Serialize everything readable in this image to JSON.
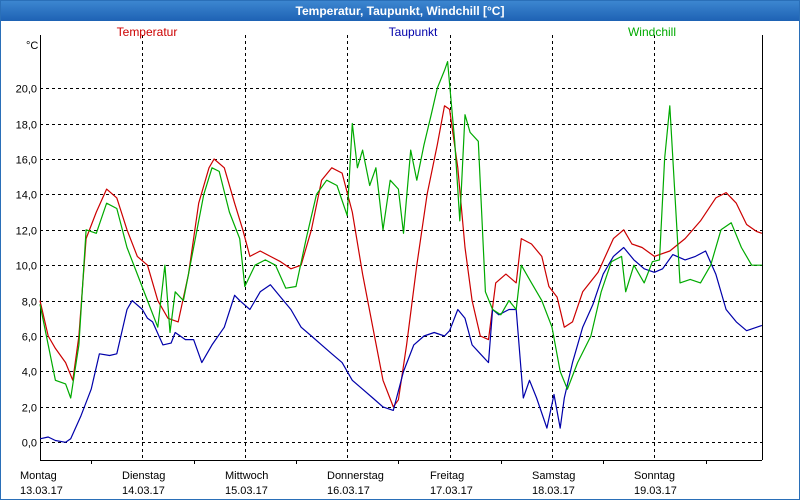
{
  "window": {
    "title": "Temperatur, Taupunkt, Windchill [°C]"
  },
  "chart_data": {
    "type": "line",
    "title": "Temperatur, Taupunkt, Windchill [°C]",
    "ylabel": "°C",
    "ylim": [
      -1.0,
      23.0
    ],
    "xlim": [
      0,
      7.05
    ],
    "grid": true,
    "x_unit_note": "days from Montag 13.03.17 00:00",
    "y_ticks": [
      "0,0",
      "2,0",
      "4,0",
      "6,0",
      "8,0",
      "10,0",
      "12,0",
      "14,0",
      "16,0",
      "18,0",
      "20,0"
    ],
    "y_tick_values": [
      0,
      2,
      4,
      6,
      8,
      10,
      12,
      14,
      16,
      18,
      20
    ],
    "x_ticks": [
      {
        "day": "Montag",
        "date": "13.03.17",
        "x": 0
      },
      {
        "day": "Dienstag",
        "date": "14.03.17",
        "x": 1
      },
      {
        "day": "Mittwoch",
        "date": "15.03.17",
        "x": 2
      },
      {
        "day": "Donnerstag",
        "date": "16.03.17",
        "x": 3
      },
      {
        "day": "Freitag",
        "date": "17.03.17",
        "x": 4
      },
      {
        "day": "Samstag",
        "date": "18.03.17",
        "x": 5
      },
      {
        "day": "Sonntag",
        "date": "19.03.17",
        "x": 6
      }
    ],
    "series": [
      {
        "name": "Temperatur",
        "color": "#cc0000",
        "points": [
          [
            0,
            8.0
          ],
          [
            0.08,
            6.0
          ],
          [
            0.15,
            5.3
          ],
          [
            0.25,
            4.5
          ],
          [
            0.32,
            3.5
          ],
          [
            0.38,
            6.0
          ],
          [
            0.45,
            11.5
          ],
          [
            0.55,
            13.0
          ],
          [
            0.65,
            14.3
          ],
          [
            0.75,
            13.8
          ],
          [
            0.85,
            12.0
          ],
          [
            0.95,
            10.5
          ],
          [
            1.05,
            10.0
          ],
          [
            1.15,
            8.0
          ],
          [
            1.25,
            7.0
          ],
          [
            1.35,
            6.8
          ],
          [
            1.45,
            9.5
          ],
          [
            1.55,
            13.5
          ],
          [
            1.65,
            15.5
          ],
          [
            1.7,
            16.0
          ],
          [
            1.8,
            15.5
          ],
          [
            1.9,
            13.5
          ],
          [
            1.98,
            12.0
          ],
          [
            2.05,
            10.5
          ],
          [
            2.15,
            10.8
          ],
          [
            2.25,
            10.5
          ],
          [
            2.35,
            10.2
          ],
          [
            2.45,
            9.8
          ],
          [
            2.55,
            10.0
          ],
          [
            2.65,
            12.0
          ],
          [
            2.75,
            14.8
          ],
          [
            2.85,
            15.5
          ],
          [
            2.95,
            15.2
          ],
          [
            3.05,
            13.0
          ],
          [
            3.15,
            9.5
          ],
          [
            3.25,
            6.5
          ],
          [
            3.35,
            3.5
          ],
          [
            3.45,
            2.0
          ],
          [
            3.5,
            2.4
          ],
          [
            3.58,
            5.5
          ],
          [
            3.68,
            10.0
          ],
          [
            3.78,
            14.0
          ],
          [
            3.88,
            16.8
          ],
          [
            3.95,
            19.0
          ],
          [
            4.0,
            18.8
          ],
          [
            4.08,
            15.5
          ],
          [
            4.15,
            11.0
          ],
          [
            4.22,
            8.0
          ],
          [
            4.3,
            6.0
          ],
          [
            4.38,
            5.8
          ],
          [
            4.45,
            9.0
          ],
          [
            4.55,
            9.5
          ],
          [
            4.65,
            9.0
          ],
          [
            4.7,
            11.5
          ],
          [
            4.8,
            11.2
          ],
          [
            4.9,
            10.5
          ],
          [
            4.97,
            8.8
          ],
          [
            5.05,
            8.2
          ],
          [
            5.12,
            6.5
          ],
          [
            5.2,
            6.8
          ],
          [
            5.3,
            8.5
          ],
          [
            5.45,
            9.6
          ],
          [
            5.6,
            11.5
          ],
          [
            5.7,
            12.0
          ],
          [
            5.78,
            11.2
          ],
          [
            5.88,
            11.0
          ],
          [
            6.0,
            10.5
          ],
          [
            6.15,
            10.8
          ],
          [
            6.3,
            11.5
          ],
          [
            6.45,
            12.5
          ],
          [
            6.6,
            13.8
          ],
          [
            6.7,
            14.1
          ],
          [
            6.8,
            13.5
          ],
          [
            6.9,
            12.3
          ],
          [
            7.0,
            11.9
          ],
          [
            7.05,
            11.8
          ]
        ]
      },
      {
        "name": "Taupunkt",
        "color": "#0000aa",
        "points": [
          [
            0,
            0.2
          ],
          [
            0.08,
            0.3
          ],
          [
            0.15,
            0.1
          ],
          [
            0.25,
            0.0
          ],
          [
            0.3,
            0.2
          ],
          [
            0.4,
            1.5
          ],
          [
            0.5,
            3.0
          ],
          [
            0.58,
            5.0
          ],
          [
            0.68,
            4.9
          ],
          [
            0.75,
            5.0
          ],
          [
            0.85,
            7.5
          ],
          [
            0.9,
            8.0
          ],
          [
            1.0,
            7.5
          ],
          [
            1.05,
            7.0
          ],
          [
            1.1,
            6.8
          ],
          [
            1.2,
            5.5
          ],
          [
            1.28,
            5.6
          ],
          [
            1.32,
            6.2
          ],
          [
            1.42,
            5.8
          ],
          [
            1.5,
            5.8
          ],
          [
            1.58,
            4.5
          ],
          [
            1.68,
            5.5
          ],
          [
            1.8,
            6.5
          ],
          [
            1.9,
            8.3
          ],
          [
            1.95,
            8.0
          ],
          [
            2.05,
            7.5
          ],
          [
            2.15,
            8.5
          ],
          [
            2.25,
            8.9
          ],
          [
            2.35,
            8.2
          ],
          [
            2.45,
            7.5
          ],
          [
            2.55,
            6.5
          ],
          [
            2.65,
            6.0
          ],
          [
            2.75,
            5.5
          ],
          [
            2.85,
            5.0
          ],
          [
            2.95,
            4.5
          ],
          [
            3.05,
            3.5
          ],
          [
            3.15,
            3.0
          ],
          [
            3.25,
            2.5
          ],
          [
            3.35,
            2.0
          ],
          [
            3.45,
            1.8
          ],
          [
            3.55,
            4.0
          ],
          [
            3.65,
            5.5
          ],
          [
            3.75,
            6.0
          ],
          [
            3.85,
            6.2
          ],
          [
            3.95,
            6.0
          ],
          [
            4.0,
            6.3
          ],
          [
            4.08,
            7.5
          ],
          [
            4.15,
            7.0
          ],
          [
            4.22,
            5.5
          ],
          [
            4.3,
            5.0
          ],
          [
            4.38,
            4.5
          ],
          [
            4.42,
            7.5
          ],
          [
            4.48,
            7.2
          ],
          [
            4.58,
            7.5
          ],
          [
            4.65,
            7.5
          ],
          [
            4.72,
            2.5
          ],
          [
            4.78,
            3.5
          ],
          [
            4.85,
            2.5
          ],
          [
            4.95,
            0.8
          ],
          [
            5.02,
            2.7
          ],
          [
            5.08,
            0.8
          ],
          [
            5.12,
            2.5
          ],
          [
            5.2,
            4.5
          ],
          [
            5.3,
            6.5
          ],
          [
            5.4,
            7.8
          ],
          [
            5.5,
            9.5
          ],
          [
            5.6,
            10.5
          ],
          [
            5.7,
            11.0
          ],
          [
            5.8,
            10.3
          ],
          [
            5.9,
            9.8
          ],
          [
            6.0,
            9.6
          ],
          [
            6.08,
            9.8
          ],
          [
            6.18,
            10.6
          ],
          [
            6.3,
            10.3
          ],
          [
            6.4,
            10.5
          ],
          [
            6.5,
            10.8
          ],
          [
            6.6,
            9.5
          ],
          [
            6.7,
            7.5
          ],
          [
            6.8,
            6.8
          ],
          [
            6.9,
            6.3
          ],
          [
            7.0,
            6.5
          ],
          [
            7.05,
            6.6
          ]
        ]
      },
      {
        "name": "Windchill",
        "color": "#00aa00",
        "points": [
          [
            0,
            7.8
          ],
          [
            0.08,
            5.5
          ],
          [
            0.15,
            3.5
          ],
          [
            0.25,
            3.3
          ],
          [
            0.3,
            2.5
          ],
          [
            0.38,
            5.5
          ],
          [
            0.45,
            12.0
          ],
          [
            0.55,
            11.8
          ],
          [
            0.65,
            13.5
          ],
          [
            0.75,
            13.2
          ],
          [
            0.85,
            11.0
          ],
          [
            0.95,
            9.5
          ],
          [
            1.05,
            8.0
          ],
          [
            1.15,
            6.5
          ],
          [
            1.22,
            10.0
          ],
          [
            1.27,
            6.2
          ],
          [
            1.32,
            8.5
          ],
          [
            1.4,
            8.0
          ],
          [
            1.5,
            11.0
          ],
          [
            1.6,
            14.0
          ],
          [
            1.68,
            15.5
          ],
          [
            1.75,
            15.3
          ],
          [
            1.85,
            13.0
          ],
          [
            1.95,
            11.5
          ],
          [
            2.0,
            8.8
          ],
          [
            2.1,
            10.0
          ],
          [
            2.2,
            10.3
          ],
          [
            2.3,
            10.0
          ],
          [
            2.4,
            8.7
          ],
          [
            2.5,
            8.8
          ],
          [
            2.6,
            11.5
          ],
          [
            2.7,
            14.0
          ],
          [
            2.8,
            14.8
          ],
          [
            2.9,
            14.5
          ],
          [
            3.0,
            12.8
          ],
          [
            3.05,
            18.0
          ],
          [
            3.1,
            15.5
          ],
          [
            3.15,
            16.5
          ],
          [
            3.22,
            14.5
          ],
          [
            3.28,
            15.5
          ],
          [
            3.35,
            12.0
          ],
          [
            3.42,
            14.8
          ],
          [
            3.5,
            14.3
          ],
          [
            3.55,
            11.8
          ],
          [
            3.62,
            16.5
          ],
          [
            3.68,
            14.8
          ],
          [
            3.75,
            16.8
          ],
          [
            3.82,
            18.5
          ],
          [
            3.88,
            20.0
          ],
          [
            3.95,
            21.0
          ],
          [
            3.98,
            21.5
          ],
          [
            4.05,
            17.0
          ],
          [
            4.1,
            12.5
          ],
          [
            4.15,
            18.5
          ],
          [
            4.2,
            17.5
          ],
          [
            4.28,
            17.0
          ],
          [
            4.35,
            8.5
          ],
          [
            4.42,
            7.5
          ],
          [
            4.5,
            7.2
          ],
          [
            4.58,
            8.0
          ],
          [
            4.65,
            7.5
          ],
          [
            4.7,
            10.0
          ],
          [
            4.8,
            9.0
          ],
          [
            4.9,
            8.0
          ],
          [
            5.0,
            6.5
          ],
          [
            5.08,
            4.0
          ],
          [
            5.15,
            3.0
          ],
          [
            5.25,
            4.5
          ],
          [
            5.38,
            6.0
          ],
          [
            5.48,
            8.5
          ],
          [
            5.58,
            10.2
          ],
          [
            5.68,
            10.5
          ],
          [
            5.72,
            8.5
          ],
          [
            5.8,
            10.0
          ],
          [
            5.9,
            9.0
          ],
          [
            5.98,
            10.2
          ],
          [
            6.05,
            10.3
          ],
          [
            6.1,
            16.0
          ],
          [
            6.15,
            19.0
          ],
          [
            6.2,
            14.0
          ],
          [
            6.25,
            9.0
          ],
          [
            6.35,
            9.2
          ],
          [
            6.45,
            9.0
          ],
          [
            6.55,
            10.0
          ],
          [
            6.65,
            12.0
          ],
          [
            6.75,
            12.4
          ],
          [
            6.85,
            11.0
          ],
          [
            6.95,
            10.0
          ],
          [
            7.05,
            10.0
          ]
        ]
      }
    ]
  }
}
